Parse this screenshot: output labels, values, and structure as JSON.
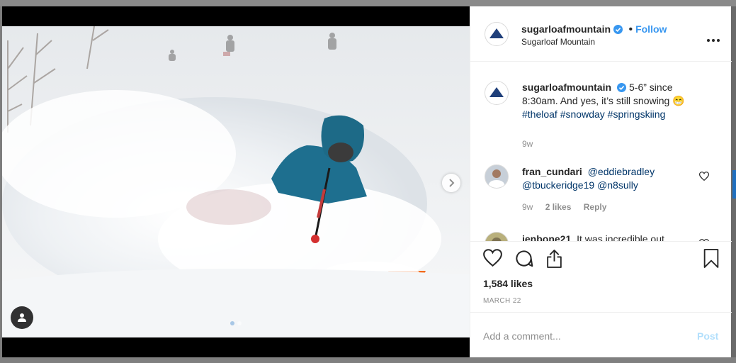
{
  "post": {
    "username": "sugarloafmountain",
    "follow_label": "Follow",
    "separator": "•",
    "location": "Sugarloaf Mountain",
    "likes": "1,584 likes",
    "date": "MARCH 22",
    "add_comment_placeholder": "Add a comment...",
    "post_label": "Post",
    "carousel_index": 1,
    "carousel_count": 2
  },
  "caption": {
    "username": "sugarloafmountain",
    "text": "5-6” since 8:30am. And yes, it’s still snowing",
    "emoji": "😁",
    "hashtags": [
      "#theloaf",
      "#snowday",
      "#springskiing"
    ],
    "time": "9w"
  },
  "comments": [
    {
      "username": "fran_cundari",
      "mentions": [
        "@eddiebradley",
        "@tbuckeridge19",
        "@n8sully"
      ],
      "time": "9w",
      "likes": "2 likes",
      "reply_label": "Reply"
    },
    {
      "username": "jenbone21",
      "text": "It was incredible out"
    }
  ],
  "icons": {
    "more": "more-options-icon",
    "verified": "verified-badge-icon",
    "like": "heart-icon",
    "comment": "comment-icon",
    "share": "share-icon",
    "save": "bookmark-icon",
    "next": "chevron-right-icon",
    "tag": "user-tag-icon"
  },
  "colors": {
    "accent": "#3897f0",
    "link": "#003569",
    "muted": "#8e8e8e",
    "post_disabled": "#b2dffc"
  }
}
